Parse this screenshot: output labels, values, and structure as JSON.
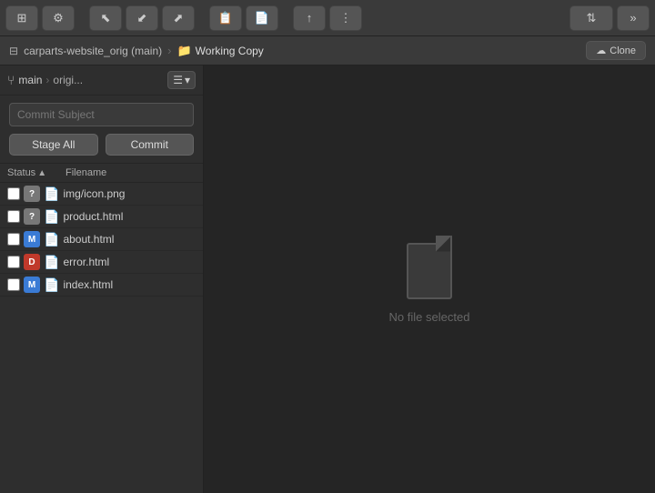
{
  "toolbar": {
    "buttons": [
      {
        "id": "settings",
        "icon": "⊞",
        "label": "settings"
      },
      {
        "id": "tools",
        "icon": "⚙",
        "label": "tools"
      },
      {
        "id": "fetch",
        "icon": "↙",
        "label": "fetch"
      },
      {
        "id": "pull",
        "icon": "↙",
        "label": "pull"
      },
      {
        "id": "push",
        "icon": "↗",
        "label": "push"
      },
      {
        "id": "stage",
        "icon": "📋",
        "label": "stage"
      },
      {
        "id": "unstage",
        "icon": "📋",
        "label": "unstage"
      },
      {
        "id": "commit-action",
        "icon": "↑",
        "label": "commit-action"
      },
      {
        "id": "more",
        "icon": "⋮",
        "label": "more"
      },
      {
        "id": "sort",
        "icon": "⇅",
        "label": "sort"
      },
      {
        "id": "overflow",
        "icon": "»",
        "label": "overflow"
      }
    ]
  },
  "breadcrumb": {
    "repo": "carparts-website_orig (main)",
    "separator": "›",
    "active_icon": "📁",
    "active_label": "Working Copy",
    "clone_label": "Clone"
  },
  "branch_bar": {
    "icon": "⑂",
    "branch": "main",
    "separator": "›",
    "origin": "origi...",
    "menu_icon": "☰",
    "dropdown_icon": "▾"
  },
  "commit": {
    "placeholder": "Commit Subject",
    "stage_all_label": "Stage All",
    "commit_label": "Commit"
  },
  "file_table": {
    "col_status": "Status",
    "col_filename": "Filename",
    "files": [
      {
        "id": 1,
        "badge": "?",
        "badge_class": "badge-gray",
        "name": "img/icon.png",
        "checked": false
      },
      {
        "id": 2,
        "badge": "?",
        "badge_class": "badge-gray",
        "name": "product.html",
        "checked": false
      },
      {
        "id": 3,
        "badge": "M",
        "badge_class": "badge-blue",
        "name": "about.html",
        "checked": false
      },
      {
        "id": 4,
        "badge": "D",
        "badge_class": "badge-red",
        "name": "error.html",
        "checked": false
      },
      {
        "id": 5,
        "badge": "M",
        "badge_class": "badge-blue",
        "name": "index.html",
        "checked": false
      }
    ]
  },
  "right_panel": {
    "no_file_label": "No file selected"
  }
}
